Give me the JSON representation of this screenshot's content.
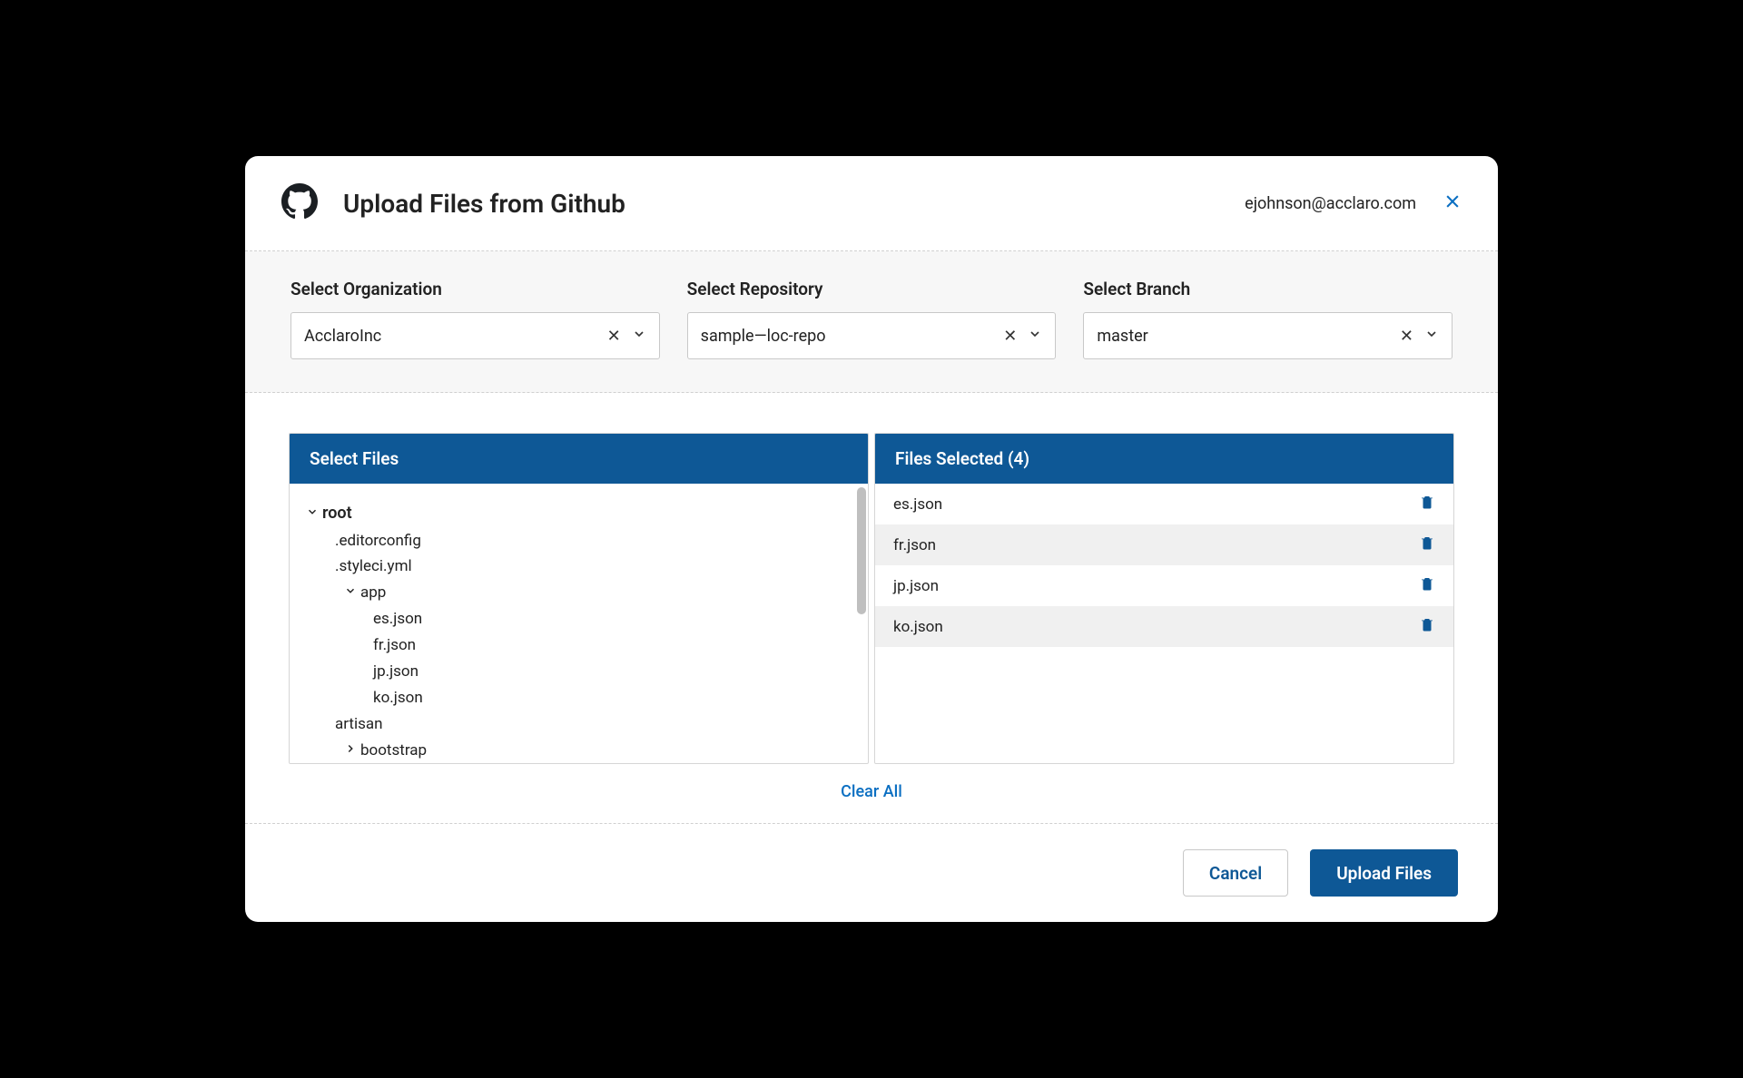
{
  "header": {
    "title": "Upload Files from Github",
    "user_email": "ejohnson@acclaro.com"
  },
  "selectors": {
    "organization": {
      "label": "Select Organization",
      "value": "AcclaroInc"
    },
    "repository": {
      "label": "Select Repository",
      "value": "sample—loc-repo"
    },
    "branch": {
      "label": "Select Branch",
      "value": "master"
    }
  },
  "left_panel": {
    "title": "Select Files",
    "tree": {
      "root_label": "root",
      "items": [
        {
          "label": ".editorconfig",
          "indent": 1,
          "folder": false
        },
        {
          "label": ".styleci.yml",
          "indent": 1,
          "folder": false
        },
        {
          "label": "app",
          "indent": 2,
          "folder": true,
          "expanded": true
        },
        {
          "label": "es.json",
          "indent": 3,
          "folder": false
        },
        {
          "label": "fr.json",
          "indent": 3,
          "folder": false
        },
        {
          "label": "jp.json",
          "indent": 3,
          "folder": false
        },
        {
          "label": "ko.json",
          "indent": 3,
          "folder": false
        },
        {
          "label": "artisan",
          "indent": 1,
          "folder": false
        },
        {
          "label": "bootstrap",
          "indent": 2,
          "folder": true,
          "expanded": false
        }
      ]
    }
  },
  "right_panel": {
    "title": "Files Selected (4)",
    "items": [
      {
        "name": "es.json"
      },
      {
        "name": "fr.json"
      },
      {
        "name": "jp.json"
      },
      {
        "name": "ko.json"
      }
    ]
  },
  "actions": {
    "clear_all": "Clear All",
    "cancel": "Cancel",
    "upload": "Upload Files"
  }
}
